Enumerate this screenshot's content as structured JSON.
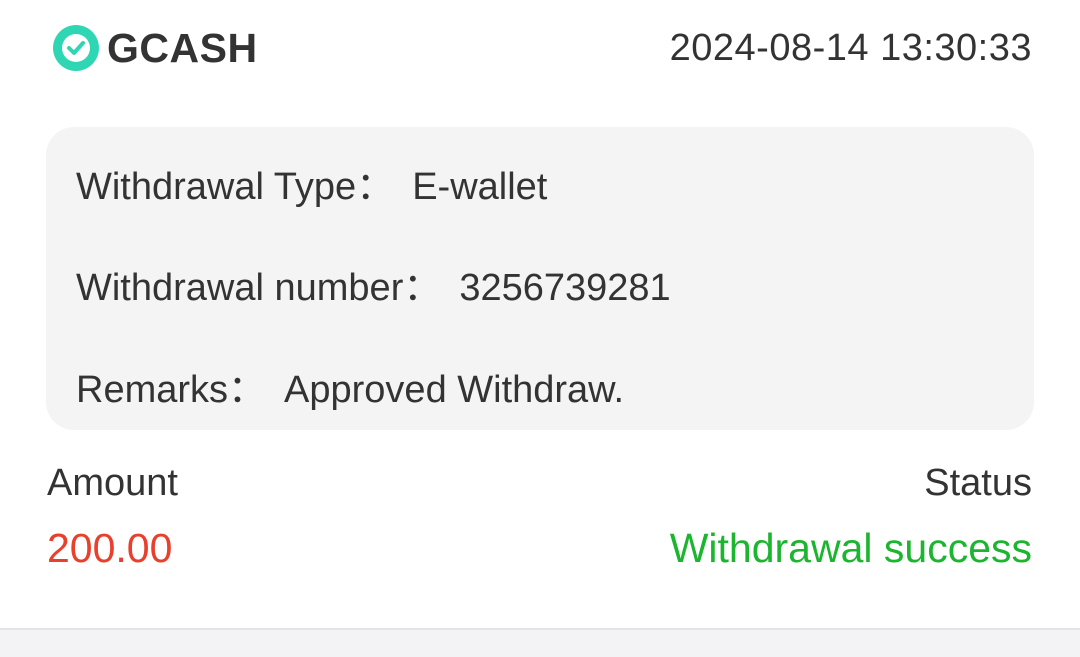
{
  "header": {
    "brand_name": "GCASH",
    "logo_icon": "gcash-logo-icon",
    "timestamp": "2024-08-14 13:30:33"
  },
  "details": {
    "withdrawal_type_label": "Withdrawal Type：",
    "withdrawal_type_value": "E-wallet",
    "withdrawal_number_label": "Withdrawal number：",
    "withdrawal_number_value": "3256739281",
    "remarks_label": "Remarks：",
    "remarks_value": "Approved Withdraw."
  },
  "summary": {
    "amount_label": "Amount",
    "amount_value": "200.00",
    "status_label": "Status",
    "status_value": "Withdrawal success"
  },
  "colors": {
    "brand_teal": "#2fd6b4",
    "amount_red": "#e8402c",
    "status_green": "#1cb52f",
    "text_dark": "#333333",
    "panel_gray": "#f4f4f4"
  }
}
